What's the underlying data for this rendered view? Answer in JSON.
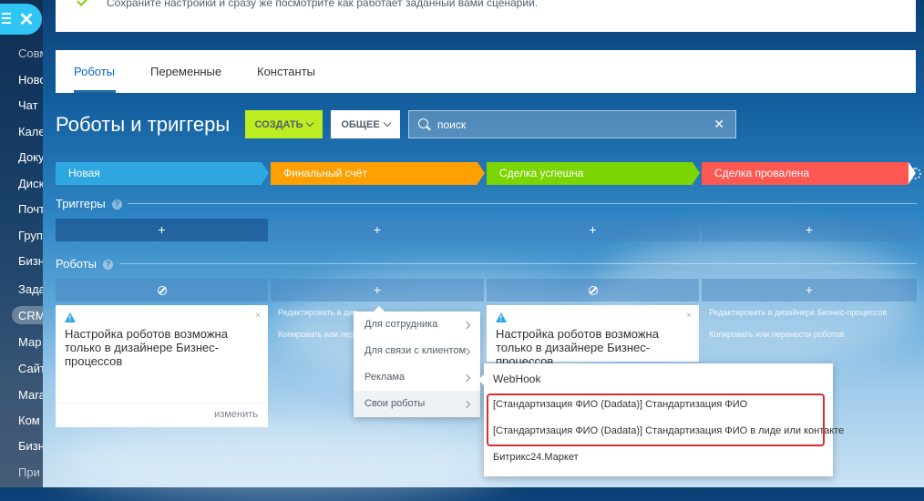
{
  "sidebar": {
    "items": [
      {
        "label": "Совм",
        "dim": true
      },
      {
        "label": "Ново"
      },
      {
        "label": "Чат"
      },
      {
        "label": "Кале"
      },
      {
        "label": "Доку"
      },
      {
        "label": "Диск"
      },
      {
        "label": "Почт"
      },
      {
        "label": "Груп"
      },
      {
        "label": "Бизн"
      },
      {
        "label": "Зада"
      },
      {
        "label": "CRM",
        "active": true
      },
      {
        "label": "Мар"
      },
      {
        "label": "Сайт"
      },
      {
        "label": "Мага"
      },
      {
        "label": "Ком"
      },
      {
        "label": "Бизн"
      },
      {
        "label": "При",
        "dim": true
      }
    ]
  },
  "notice": {
    "text": "Сохраните настройки и сразу же посмотрите как работает заданный вами сценарии."
  },
  "tabs": [
    {
      "label": "Роботы",
      "active": true
    },
    {
      "label": "Переменные"
    },
    {
      "label": "Константы"
    }
  ],
  "header": {
    "title": "Роботы и триггеры",
    "create_label": "СОЗДАТЬ",
    "general_label": "ОБЩЕЕ",
    "search_placeholder": "поиск",
    "clear_symbol": "✕"
  },
  "stages": [
    {
      "label": "Новая",
      "color": "#2fa8e1"
    },
    {
      "label": "Финальный счёт",
      "color": "#ff9f00"
    },
    {
      "label": "Сделка успешна",
      "color": "#7bd500"
    },
    {
      "label": "Сделка провалена",
      "color": "#ff5752"
    }
  ],
  "triggers": {
    "title": "Триггеры",
    "add_symbol": "+",
    "help": "?"
  },
  "robots": {
    "title": "Роботы",
    "add_symbol": "+",
    "help": "?"
  },
  "cards": [
    {
      "message": "Настройка роботов возможна только в дизайнере Бизнес-процессов",
      "action": "изменить"
    },
    {
      "message": "Настройка роботов возможна только в дизайнере Бизнес-процессов"
    }
  ],
  "hints": {
    "edit": "Редактировать в дизайнере Бизнес-процессов",
    "edit_short": "Редактировать в дис",
    "copy": "Копировать или перенести роботов",
    "copy_short": "Копировать или перен"
  },
  "close_symbol": "×",
  "menu": {
    "items": [
      {
        "label": "Для сотрудника"
      },
      {
        "label": "Для связи с клиентом"
      },
      {
        "label": "Реклама"
      },
      {
        "label": "Свои роботы",
        "selected": true
      }
    ]
  },
  "submenu": {
    "items": [
      {
        "label": "WebHook"
      },
      {
        "label": "[Стандартизация ФИО (Dadata)] Стандартизация ФИО"
      },
      {
        "label": "[Стандартизация ФИО (Dadata)] Стандартизация ФИО в лиде или контакте"
      },
      {
        "label": "Битрикс24.Маркет"
      }
    ]
  }
}
